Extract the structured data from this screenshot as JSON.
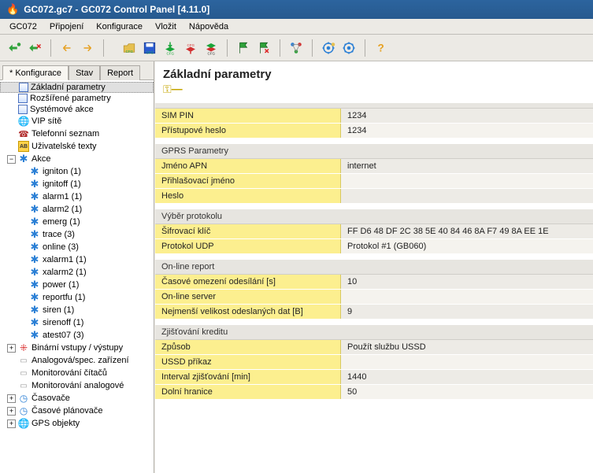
{
  "window": {
    "title": "GC072.gc7 - GC072 Control Panel [4.11.0]"
  },
  "menu": {
    "items": [
      "GC072",
      "Připojení",
      "Konfigurace",
      "Vložit",
      "Nápověda"
    ]
  },
  "sidebar": {
    "tabs": {
      "t0": "Konfigurace",
      "t1": "Stav",
      "t2": "Report"
    },
    "nodes": {
      "basic": "Základní parametry",
      "ext": "Rozšířené parametry",
      "sysact": "Systémové akce",
      "vip": "VIP sítě",
      "phone": "Telefonní seznam",
      "usertxt": "Uživatelské texty",
      "actions": "Akce",
      "a_igniton": "igniton (1)",
      "a_ignitoff": "ignitoff (1)",
      "a_alarm1": "alarm1 (1)",
      "a_alarm2": "alarm2 (1)",
      "a_emerg": "emerg (1)",
      "a_trace": "trace (3)",
      "a_online": "online (3)",
      "a_xalarm1": "xalarm1 (1)",
      "a_xalarm2": "xalarm2 (1)",
      "a_power": "power (1)",
      "a_reportfu": "reportfu (1)",
      "a_siren": "siren (1)",
      "a_sirenoff": "sirenoff (1)",
      "a_atest07": "atest07 (3)",
      "bin": "Binární vstupy / výstupy",
      "analog": "Analogová/spec. zařízení",
      "moncount": "Monitorování čítačů",
      "monanalog": "Monitorování analogové",
      "timers": "Časovače",
      "sched": "Časové plánovače",
      "gps": "GPS objekty"
    }
  },
  "page": {
    "title": "Základní parametry"
  },
  "sec_basic": {
    "title": "",
    "sim_pin": {
      "label": "SIM PIN",
      "value": "1234"
    },
    "password": {
      "label": "Přístupové heslo",
      "value": "1234"
    }
  },
  "sec_gprs": {
    "title": "GPRS Parametry",
    "apn": {
      "label": "Jméno APN",
      "value": "internet"
    },
    "user": {
      "label": "Přihlašovací jméno",
      "value": ""
    },
    "pass": {
      "label": "Heslo",
      "value": ""
    }
  },
  "sec_proto": {
    "title": "Výběr protokolu",
    "key": {
      "label": "Šifrovací klíč",
      "value": "FF D6 48 DF 2C 38 5E 40 84 46 8A F7 49 8A EE 1E"
    },
    "udp": {
      "label": "Protokol UDP",
      "value": "Protokol #1 (GB060)"
    }
  },
  "sec_online": {
    "title": "On-line report",
    "timeout": {
      "label": "Časové omezení odesílání [s]",
      "value": "10"
    },
    "server": {
      "label": "On-line server",
      "value": ""
    },
    "minsize": {
      "label": "Nejmenší velikost odeslaných dat [B]",
      "value": "9"
    }
  },
  "sec_credit": {
    "title": "Zjišťování kreditu",
    "method": {
      "label": "Způsob",
      "value": "Použít službu USSD"
    },
    "ussd": {
      "label": "USSD příkaz",
      "value": ""
    },
    "interval": {
      "label": "Interval zjišťování [min]",
      "value": "1440"
    },
    "low": {
      "label": "Dolní hranice",
      "value": "50"
    }
  }
}
